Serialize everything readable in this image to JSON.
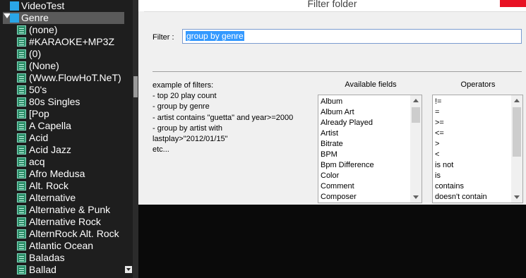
{
  "tree": {
    "items": [
      {
        "label": "VideoTest",
        "icon": "filter-icon",
        "level": 0,
        "selected": false
      },
      {
        "label": "Genre",
        "icon": "filter-icon",
        "level": 0,
        "selected": true
      },
      {
        "label": "(none)",
        "icon": "folder-icon",
        "level": 1
      },
      {
        "label": "#KARAOKE+MP3Z",
        "icon": "folder-icon",
        "level": 1
      },
      {
        "label": "(0)",
        "icon": "folder-icon",
        "level": 1
      },
      {
        "label": "(None)",
        "icon": "folder-icon",
        "level": 1
      },
      {
        "label": "(Www.FlowHoT.NeT)",
        "icon": "folder-icon",
        "level": 1
      },
      {
        "label": "50's",
        "icon": "folder-icon",
        "level": 1
      },
      {
        "label": "80s Singles",
        "icon": "folder-icon",
        "level": 1
      },
      {
        "label": "[Pop",
        "icon": "folder-icon",
        "level": 1
      },
      {
        "label": "A Capella",
        "icon": "folder-icon",
        "level": 1
      },
      {
        "label": "Acid",
        "icon": "folder-icon",
        "level": 1
      },
      {
        "label": "Acid Jazz",
        "icon": "folder-icon",
        "level": 1
      },
      {
        "label": "acq",
        "icon": "folder-icon",
        "level": 1
      },
      {
        "label": "Afro Medusa",
        "icon": "folder-icon",
        "level": 1
      },
      {
        "label": "Alt. Rock",
        "icon": "folder-icon",
        "level": 1
      },
      {
        "label": "Alternative",
        "icon": "folder-icon",
        "level": 1
      },
      {
        "label": "Alternative & Punk",
        "icon": "folder-icon",
        "level": 1
      },
      {
        "label": "Alternative Rock",
        "icon": "folder-icon",
        "level": 1
      },
      {
        "label": "AlternRock Alt. Rock",
        "icon": "folder-icon",
        "level": 1
      },
      {
        "label": "Atlantic Ocean",
        "icon": "folder-icon",
        "level": 1
      },
      {
        "label": "Baladas",
        "icon": "folder-icon",
        "level": 1
      },
      {
        "label": "Ballad",
        "icon": "folder-icon",
        "level": 1
      }
    ]
  },
  "dialog": {
    "title": "Filter folder",
    "filter_label": "Filter :",
    "filter_value": "group by genre",
    "examples": [
      "example of filters:",
      "- top 20 play count",
      "- group by genre",
      "- artist contains \"guetta\" and year>=2000",
      "- group by artist with",
      "lastplay>\"2012/01/15\"",
      "etc..."
    ],
    "available_fields_header": "Available fields",
    "operators_header": "Operators",
    "fields": [
      "Album",
      "Album Art",
      "Already Played",
      "Artist",
      "Bitrate",
      "BPM",
      "Bpm Difference",
      "Color",
      "Comment",
      "Composer"
    ],
    "operators": [
      "!=",
      "=",
      ">=",
      "<=",
      ">",
      "<",
      "is not",
      "is",
      "contains",
      "doesn't contain"
    ]
  },
  "colors": {
    "tree_bg": "#1e1e1e",
    "selected_row": "#5a5a5a",
    "dialog_bg": "#f0f0f0",
    "close_button": "#e81123",
    "selection_highlight": "#3399ff"
  }
}
